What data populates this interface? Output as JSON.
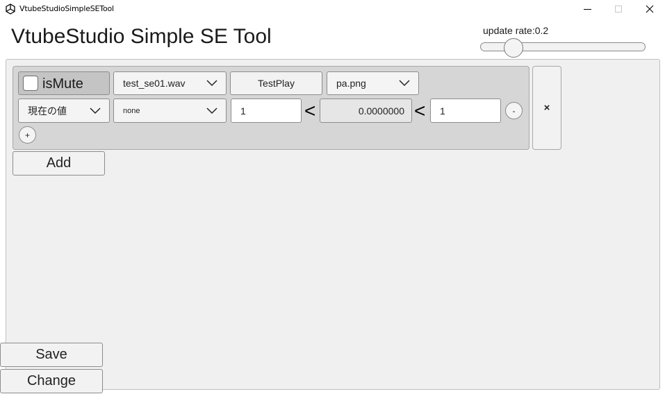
{
  "window": {
    "title": "VtubeStudioSimpleSETool",
    "icon": "unity-logo-icon",
    "minimize_icon": "minimize-icon",
    "maximize_icon": "maximize-icon",
    "close_icon": "close-icon"
  },
  "header": {
    "title": "VtubeStudio Simple SE Tool",
    "update_rate_label": "update rate:0.2",
    "update_rate_value": 0.2
  },
  "entries": [
    {
      "mute_label": "isMute",
      "mute_checked": false,
      "sound_file": "test_se01.wav",
      "test_play_label": "TestPlay",
      "image_file": "pa.png",
      "conditions": [
        {
          "mode": "現在の値",
          "parameter": "none",
          "min_value": "1",
          "less_than_1": "<",
          "current_value": "0.0000000",
          "less_than_2": "<",
          "max_value": "1",
          "remove_label": "-"
        }
      ],
      "add_condition_label": "+",
      "remove_entry_label": "×"
    }
  ],
  "actions": {
    "add_label": "Add",
    "save_label": "Save",
    "change_label": "Change"
  },
  "colors": {
    "panel_bg": "#f0f0f0",
    "card_bg": "#d6d6d6",
    "button_bg": "#f2f2f2",
    "border": "#8c8c8c"
  }
}
